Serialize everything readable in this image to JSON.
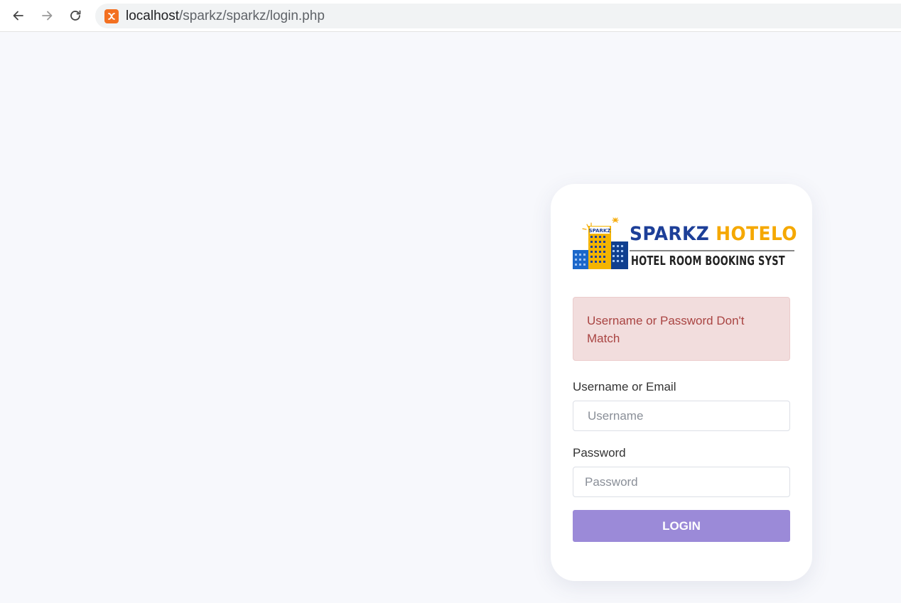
{
  "browser": {
    "url_host": "localhost",
    "url_path": "/sparkz/sparkz/login.php",
    "icons": {
      "back": "arrow-left-icon",
      "forward": "arrow-right-icon",
      "reload": "reload-icon",
      "site": "xampp-icon"
    }
  },
  "login": {
    "logo": {
      "title_part1": "SPARKZ",
      "title_part2": "HOTELO",
      "subtitle": "HOTEL ROOM BOOKING SYST",
      "building_sign": "SPARKZ"
    },
    "alert_message": "Username or Password Don't Match",
    "username_label": "Username or Email",
    "username_placeholder": "Username",
    "username_value": "",
    "password_label": "Password",
    "password_placeholder": "Password",
    "password_value": "",
    "login_button": "LOGIN"
  },
  "colors": {
    "page_background": "#f7f8fc",
    "card_background": "#ffffff",
    "alert_background": "#f2dddd",
    "alert_text": "#a94442",
    "button_background": "#9b8ad8",
    "logo_blue": "#1d3f98",
    "logo_yellow": "#f5a800"
  }
}
